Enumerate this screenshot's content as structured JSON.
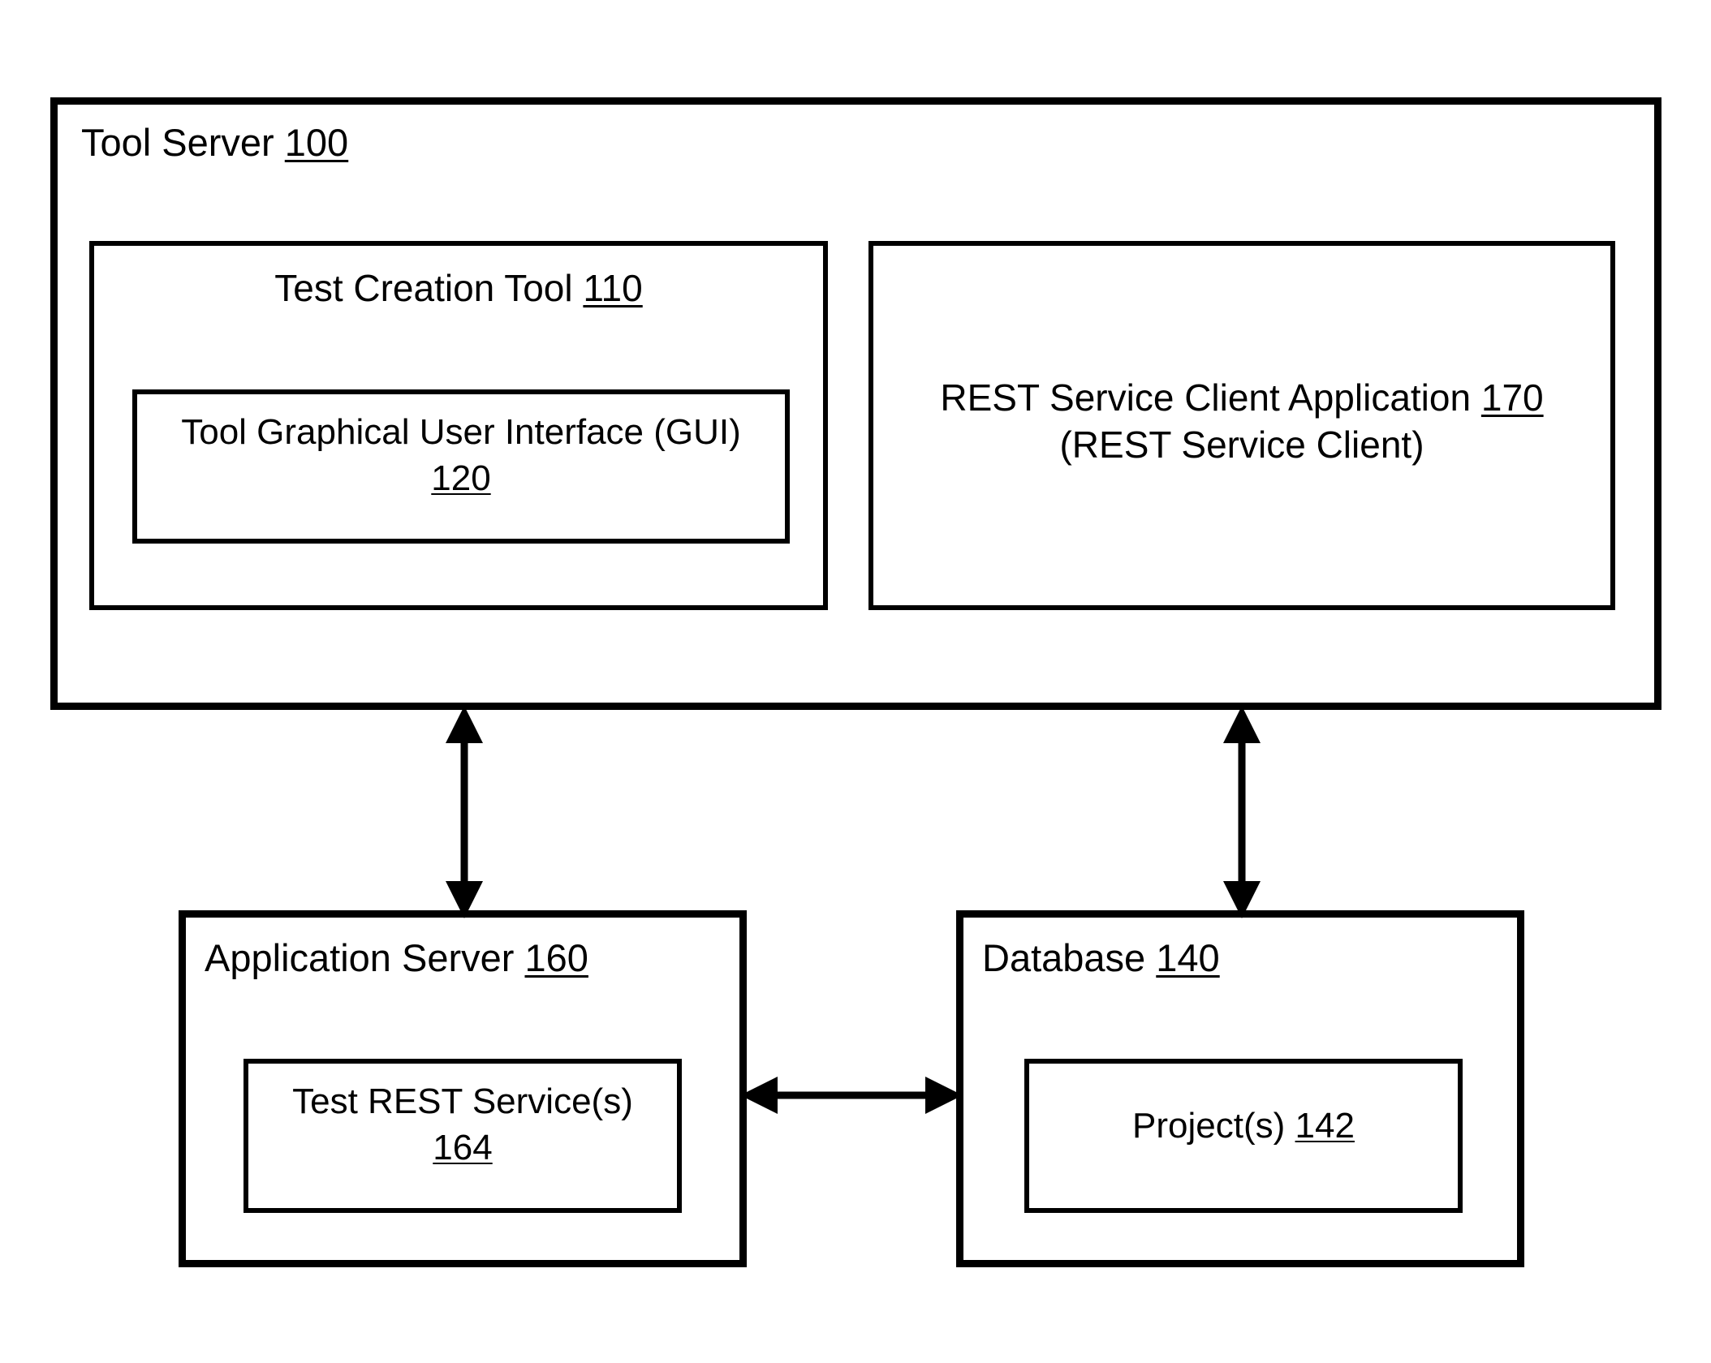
{
  "figure": {
    "title": "Tool Server architecture block diagram",
    "stroke_color": "#000000",
    "background_color": "#ffffff"
  },
  "tool_server": {
    "label": "Tool Server ",
    "ref": "100",
    "test_creation_tool": {
      "label": "Test Creation Tool ",
      "ref": "110",
      "gui": {
        "line1": "Tool Graphical User Interface (GUI)",
        "ref": "120"
      }
    },
    "rest_client": {
      "line1": "REST Service Client Application ",
      "ref": "170",
      "line2": "(REST Service Client)"
    }
  },
  "application_server": {
    "label": "Application Server ",
    "ref": "160",
    "test_rest_service": {
      "line1": "Test REST Service(s)",
      "ref": "164"
    }
  },
  "database": {
    "label": "Database ",
    "ref": "140",
    "projects": {
      "line1": "Project(s) ",
      "ref": "142"
    }
  },
  "connectors": [
    {
      "name": "tool-server-to-application-server",
      "from": "Tool Server 100",
      "to": "Application Server 160",
      "style": "double-headed-vertical"
    },
    {
      "name": "tool-server-to-database",
      "from": "Tool Server 100",
      "to": "Database 140",
      "style": "double-headed-vertical"
    },
    {
      "name": "application-server-to-database",
      "from": "Application Server 160",
      "to": "Database 140",
      "style": "double-headed-horizontal"
    }
  ]
}
